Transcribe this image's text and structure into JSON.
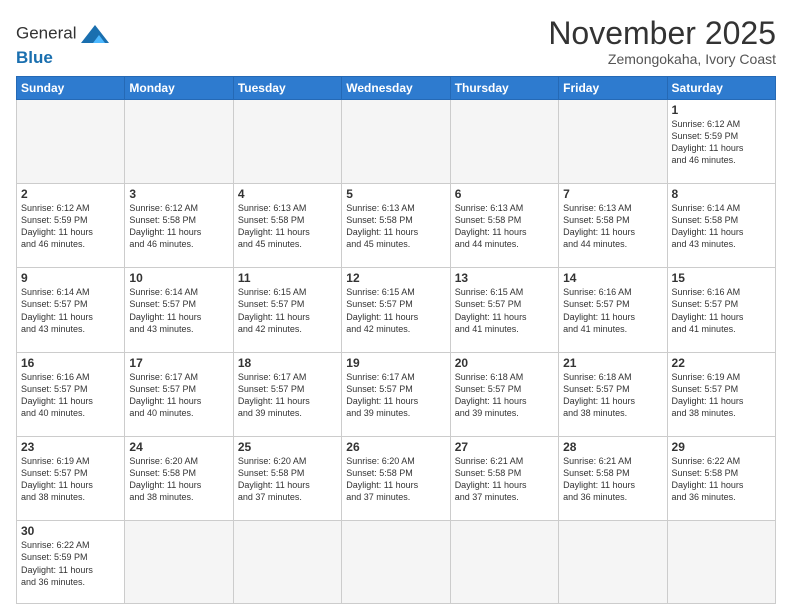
{
  "header": {
    "logo_general": "General",
    "logo_blue": "Blue",
    "title": "November 2025",
    "location": "Zemongokaha, Ivory Coast"
  },
  "weekdays": [
    "Sunday",
    "Monday",
    "Tuesday",
    "Wednesday",
    "Thursday",
    "Friday",
    "Saturday"
  ],
  "days": [
    {
      "date": "",
      "info": ""
    },
    {
      "date": "",
      "info": ""
    },
    {
      "date": "",
      "info": ""
    },
    {
      "date": "",
      "info": ""
    },
    {
      "date": "",
      "info": ""
    },
    {
      "date": "",
      "info": ""
    },
    {
      "date": "1",
      "info": "Sunrise: 6:12 AM\nSunset: 5:59 PM\nDaylight: 11 hours\nand 46 minutes."
    },
    {
      "date": "2",
      "info": "Sunrise: 6:12 AM\nSunset: 5:59 PM\nDaylight: 11 hours\nand 46 minutes."
    },
    {
      "date": "3",
      "info": "Sunrise: 6:12 AM\nSunset: 5:58 PM\nDaylight: 11 hours\nand 46 minutes."
    },
    {
      "date": "4",
      "info": "Sunrise: 6:13 AM\nSunset: 5:58 PM\nDaylight: 11 hours\nand 45 minutes."
    },
    {
      "date": "5",
      "info": "Sunrise: 6:13 AM\nSunset: 5:58 PM\nDaylight: 11 hours\nand 45 minutes."
    },
    {
      "date": "6",
      "info": "Sunrise: 6:13 AM\nSunset: 5:58 PM\nDaylight: 11 hours\nand 44 minutes."
    },
    {
      "date": "7",
      "info": "Sunrise: 6:13 AM\nSunset: 5:58 PM\nDaylight: 11 hours\nand 44 minutes."
    },
    {
      "date": "8",
      "info": "Sunrise: 6:14 AM\nSunset: 5:58 PM\nDaylight: 11 hours\nand 43 minutes."
    },
    {
      "date": "9",
      "info": "Sunrise: 6:14 AM\nSunset: 5:57 PM\nDaylight: 11 hours\nand 43 minutes."
    },
    {
      "date": "10",
      "info": "Sunrise: 6:14 AM\nSunset: 5:57 PM\nDaylight: 11 hours\nand 43 minutes."
    },
    {
      "date": "11",
      "info": "Sunrise: 6:15 AM\nSunset: 5:57 PM\nDaylight: 11 hours\nand 42 minutes."
    },
    {
      "date": "12",
      "info": "Sunrise: 6:15 AM\nSunset: 5:57 PM\nDaylight: 11 hours\nand 42 minutes."
    },
    {
      "date": "13",
      "info": "Sunrise: 6:15 AM\nSunset: 5:57 PM\nDaylight: 11 hours\nand 41 minutes."
    },
    {
      "date": "14",
      "info": "Sunrise: 6:16 AM\nSunset: 5:57 PM\nDaylight: 11 hours\nand 41 minutes."
    },
    {
      "date": "15",
      "info": "Sunrise: 6:16 AM\nSunset: 5:57 PM\nDaylight: 11 hours\nand 41 minutes."
    },
    {
      "date": "16",
      "info": "Sunrise: 6:16 AM\nSunset: 5:57 PM\nDaylight: 11 hours\nand 40 minutes."
    },
    {
      "date": "17",
      "info": "Sunrise: 6:17 AM\nSunset: 5:57 PM\nDaylight: 11 hours\nand 40 minutes."
    },
    {
      "date": "18",
      "info": "Sunrise: 6:17 AM\nSunset: 5:57 PM\nDaylight: 11 hours\nand 39 minutes."
    },
    {
      "date": "19",
      "info": "Sunrise: 6:17 AM\nSunset: 5:57 PM\nDaylight: 11 hours\nand 39 minutes."
    },
    {
      "date": "20",
      "info": "Sunrise: 6:18 AM\nSunset: 5:57 PM\nDaylight: 11 hours\nand 39 minutes."
    },
    {
      "date": "21",
      "info": "Sunrise: 6:18 AM\nSunset: 5:57 PM\nDaylight: 11 hours\nand 38 minutes."
    },
    {
      "date": "22",
      "info": "Sunrise: 6:19 AM\nSunset: 5:57 PM\nDaylight: 11 hours\nand 38 minutes."
    },
    {
      "date": "23",
      "info": "Sunrise: 6:19 AM\nSunset: 5:57 PM\nDaylight: 11 hours\nand 38 minutes."
    },
    {
      "date": "24",
      "info": "Sunrise: 6:20 AM\nSunset: 5:58 PM\nDaylight: 11 hours\nand 38 minutes."
    },
    {
      "date": "25",
      "info": "Sunrise: 6:20 AM\nSunset: 5:58 PM\nDaylight: 11 hours\nand 37 minutes."
    },
    {
      "date": "26",
      "info": "Sunrise: 6:20 AM\nSunset: 5:58 PM\nDaylight: 11 hours\nand 37 minutes."
    },
    {
      "date": "27",
      "info": "Sunrise: 6:21 AM\nSunset: 5:58 PM\nDaylight: 11 hours\nand 37 minutes."
    },
    {
      "date": "28",
      "info": "Sunrise: 6:21 AM\nSunset: 5:58 PM\nDaylight: 11 hours\nand 36 minutes."
    },
    {
      "date": "29",
      "info": "Sunrise: 6:22 AM\nSunset: 5:58 PM\nDaylight: 11 hours\nand 36 minutes."
    },
    {
      "date": "30",
      "info": "Sunrise: 6:22 AM\nSunset: 5:59 PM\nDaylight: 11 hours\nand 36 minutes."
    },
    {
      "date": "",
      "info": ""
    },
    {
      "date": "",
      "info": ""
    },
    {
      "date": "",
      "info": ""
    },
    {
      "date": "",
      "info": ""
    },
    {
      "date": "",
      "info": ""
    },
    {
      "date": "",
      "info": ""
    }
  ]
}
